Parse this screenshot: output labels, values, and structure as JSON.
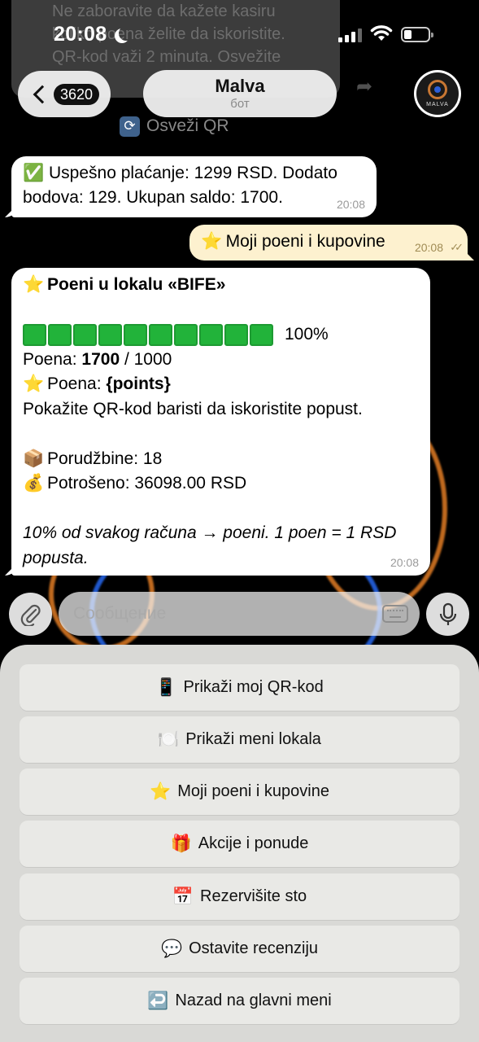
{
  "status_bar": {
    "time": "20:08"
  },
  "previous_message": {
    "lines": [
      "Ne zaboravite da kažete kasiru",
      "koliko poena želite da iskoristite.",
      "QR-kod važi 2 minuta. Osvežite"
    ]
  },
  "header": {
    "back_badge": "3620",
    "title": "Malva",
    "subtitle": "бот",
    "avatar_text": "MALVA"
  },
  "refresh_qr": {
    "label": "Osveži QR",
    "icon": "refresh-icon"
  },
  "messages": {
    "payment": {
      "emoji": "✅",
      "line1": "Uspešno plaćanje: 1299 RSD. Dodato",
      "line2": "bodova: 129. Ukupan saldo: 1700.",
      "time": "20:08"
    },
    "user_request": {
      "emoji": "⭐",
      "text": "Moji poeni i kupovine",
      "time": "20:08",
      "status": "read"
    },
    "points": {
      "title_emoji": "⭐",
      "title": "Poeni u lokalu «BIFE»",
      "progress": {
        "blocks": 10,
        "filled": 10,
        "percent_label": "100%"
      },
      "points_label": "Poena: ",
      "points_value": "1700",
      "points_total": " / 1000",
      "placeholder_emoji": "⭐",
      "placeholder_label": "Poena: ",
      "placeholder_value": "{points}",
      "qr_hint": "Pokažite QR-kod baristi da iskoristite popust.",
      "orders_emoji": "📦",
      "orders": "Porudžbine: 18",
      "spent_emoji": "💰",
      "spent": "Potrošeno: 36098.00 RSD",
      "note_line1": "10% od svakog računa → poeni. 1 poen = 1 RSD",
      "note_line2": "popusta.",
      "time": "20:08"
    }
  },
  "input": {
    "placeholder": "Сообщение"
  },
  "reply_keyboard": [
    {
      "emoji": "📱",
      "label": "Prikaži moj QR-kod"
    },
    {
      "emoji": "🍽️",
      "label": "Prikaži meni lokala"
    },
    {
      "emoji": "⭐",
      "label": "Moji poeni i kupovine"
    },
    {
      "emoji": "🎁",
      "label": "Akcije i ponude"
    },
    {
      "emoji": "📅",
      "label": "Rezervišite sto"
    },
    {
      "emoji": "💬",
      "label": "Ostavite recenziju"
    },
    {
      "emoji": "↩️",
      "label": "Nazad na glavni meni"
    }
  ],
  "colors": {
    "incoming_bubble": "#ffffff",
    "outgoing_bubble": "#fdf1cf",
    "progress_fill": "#22b33a",
    "keyboard_bg": "#d9d9d6"
  }
}
